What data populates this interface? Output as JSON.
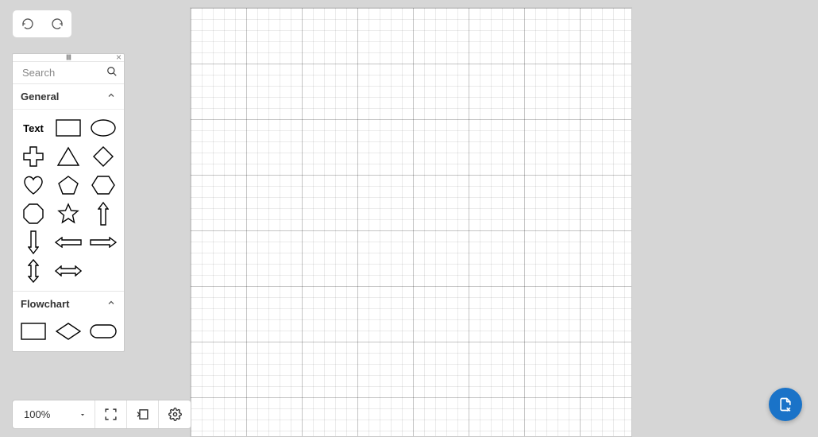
{
  "toolbar": {
    "undo_label": "Undo",
    "redo_label": "Redo"
  },
  "shapes_panel": {
    "search_placeholder": "Search",
    "sections": {
      "general": {
        "title": "General",
        "shapes": {
          "text": "Text"
        }
      },
      "flowchart": {
        "title": "Flowchart"
      }
    }
  },
  "footer": {
    "zoom": "100%"
  }
}
